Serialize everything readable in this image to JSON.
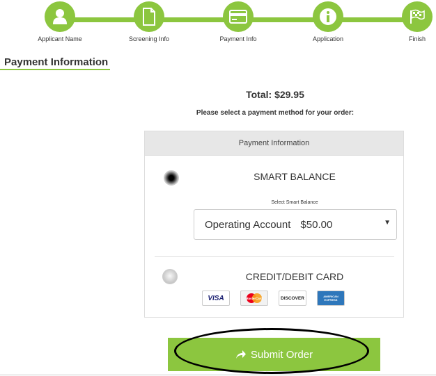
{
  "stepper": {
    "steps": [
      {
        "label": "Applicant Name",
        "icon": "user-icon"
      },
      {
        "label": "Screening Info",
        "icon": "document-icon"
      },
      {
        "label": "Payment Info",
        "icon": "credit-card-icon"
      },
      {
        "label": "Application",
        "icon": "info-icon"
      },
      {
        "label": "Finish",
        "icon": "checkered-flag-icon"
      }
    ],
    "color": "#8cc63f"
  },
  "section_title": "Payment Information",
  "total": "Total: $29.95",
  "instructions": "Please select a payment method for your order:",
  "panel": {
    "header": "Payment Information",
    "smart_balance": {
      "title": "SMART BALANCE",
      "selected": true,
      "select_label": "Select Smart Balance",
      "select_account": "Operating Account",
      "select_amount": "$50.00"
    },
    "credit_card": {
      "title": "CREDIT/DEBIT CARD",
      "selected": false,
      "cards": [
        "VISA",
        "MasterCard",
        "DISCOVER",
        "AMERICAN EXPRESS"
      ]
    }
  },
  "submit_label": "Submit Order"
}
